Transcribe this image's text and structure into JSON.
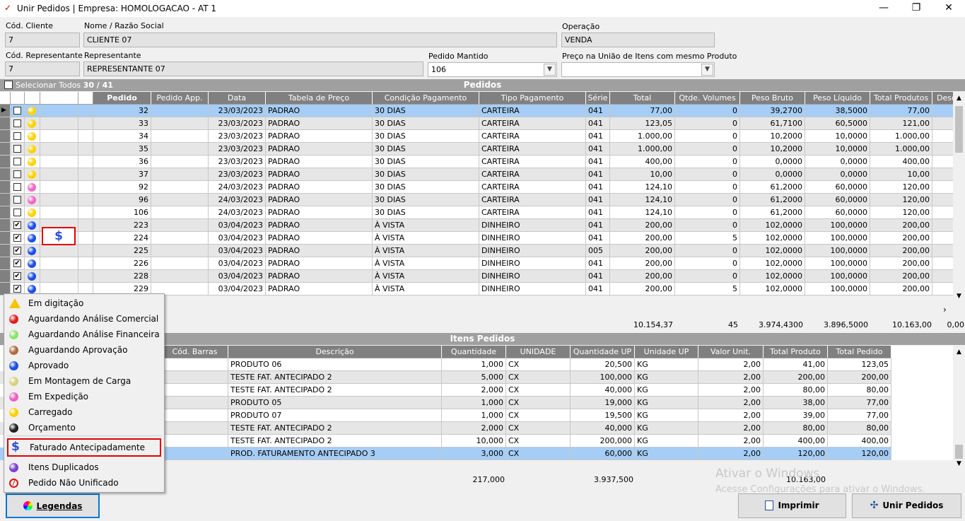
{
  "window": {
    "title": "Unir Pedidos | Empresa: HOMOLOGACAO - AT 1",
    "min": "—",
    "max": "❐",
    "close": "✕"
  },
  "form": {
    "cod_cliente_label": "Cód. Cliente",
    "cod_cliente": "7",
    "nome_label": "Nome / Razão Social",
    "nome": "CLIENTE 07",
    "operacao_label": "Operação",
    "operacao": "VENDA",
    "cod_rep_label": "Cód. Representante",
    "cod_rep": "7",
    "rep_label": "Representante",
    "rep": "REPRESENTANTE 07",
    "pedido_mantido_label": "Pedido Mantido",
    "pedido_mantido": "106",
    "preco_label": "Preço na União de Itens com mesmo Produto",
    "preco": ""
  },
  "pedidos": {
    "select_all_label": "Selecionar Todos",
    "count": "30 / 41",
    "title": "Pedidos",
    "columns": [
      "Pedido",
      "Pedido App.",
      "Data",
      "Tabela de Preço",
      "Condição Pagamento",
      "Tipo Pagamento",
      "Série",
      "Total",
      "Qtde. Volumes",
      "Peso Bruto",
      "Peso Líquido",
      "Total Produtos",
      "Desc"
    ],
    "rows": [
      {
        "checked": false,
        "status": "carregado",
        "pedido": "32",
        "app": "",
        "data": "23/03/2023",
        "tabela": "PADRAO",
        "cond": "30 DIAS",
        "tipo": "CARTEIRA",
        "serie": "041",
        "total": "77,00",
        "vol": "0",
        "bruto": "39,2700",
        "liq": "38,5000",
        "totprod": "77,00",
        "selected": true
      },
      {
        "checked": false,
        "status": "carregado",
        "pedido": "33",
        "app": "",
        "data": "23/03/2023",
        "tabela": "PADRAO",
        "cond": "30 DIAS",
        "tipo": "CARTEIRA",
        "serie": "041",
        "total": "123,05",
        "vol": "0",
        "bruto": "61,7100",
        "liq": "60,5000",
        "totprod": "121,00"
      },
      {
        "checked": false,
        "status": "carregado",
        "pedido": "34",
        "app": "",
        "data": "23/03/2023",
        "tabela": "PADRAO",
        "cond": "30 DIAS",
        "tipo": "CARTEIRA",
        "serie": "041",
        "total": "1.000,00",
        "vol": "0",
        "bruto": "10,2000",
        "liq": "10,0000",
        "totprod": "1.000,00"
      },
      {
        "checked": false,
        "status": "carregado",
        "pedido": "35",
        "app": "",
        "data": "23/03/2023",
        "tabela": "PADRAO",
        "cond": "30 DIAS",
        "tipo": "CARTEIRA",
        "serie": "041",
        "total": "1.000,00",
        "vol": "0",
        "bruto": "10,2000",
        "liq": "10,0000",
        "totprod": "1.000,00"
      },
      {
        "checked": false,
        "status": "carregado",
        "pedido": "36",
        "app": "",
        "data": "23/03/2023",
        "tabela": "PADRAO",
        "cond": "30 DIAS",
        "tipo": "CARTEIRA",
        "serie": "041",
        "total": "400,00",
        "vol": "0",
        "bruto": "0,0000",
        "liq": "0,0000",
        "totprod": "400,00"
      },
      {
        "checked": false,
        "status": "carregado",
        "pedido": "37",
        "app": "",
        "data": "23/03/2023",
        "tabela": "PADRAO",
        "cond": "30 DIAS",
        "tipo": "CARTEIRA",
        "serie": "041",
        "total": "10,00",
        "vol": "0",
        "bruto": "0,0000",
        "liq": "0,0000",
        "totprod": "10,00"
      },
      {
        "checked": false,
        "status": "expedicao",
        "pedido": "92",
        "app": "",
        "data": "24/03/2023",
        "tabela": "PADRAO",
        "cond": "30 DIAS",
        "tipo": "CARTEIRA",
        "serie": "041",
        "total": "124,10",
        "vol": "0",
        "bruto": "61,2000",
        "liq": "60,0000",
        "totprod": "120,00"
      },
      {
        "checked": false,
        "status": "expedicao",
        "pedido": "96",
        "app": "",
        "data": "24/03/2023",
        "tabela": "PADRAO",
        "cond": "30 DIAS",
        "tipo": "CARTEIRA",
        "serie": "041",
        "total": "124,10",
        "vol": "0",
        "bruto": "61,2000",
        "liq": "60,0000",
        "totprod": "120,00"
      },
      {
        "checked": false,
        "status": "carregado",
        "pedido": "106",
        "app": "",
        "data": "24/03/2023",
        "tabela": "PADRAO",
        "cond": "30 DIAS",
        "tipo": "CARTEIRA",
        "serie": "041",
        "total": "124,10",
        "vol": "0",
        "bruto": "61,2000",
        "liq": "60,0000",
        "totprod": "120,00"
      },
      {
        "checked": true,
        "status": "aprovado",
        "pedido": "223",
        "app": "",
        "data": "03/04/2023",
        "tabela": "PADRAO",
        "cond": "À VISTA",
        "tipo": "DINHEIRO",
        "serie": "041",
        "total": "200,00",
        "vol": "0",
        "bruto": "102,0000",
        "liq": "100,0000",
        "totprod": "200,00"
      },
      {
        "checked": true,
        "status": "aprovado",
        "pedido": "224",
        "app": "$",
        "data": "03/04/2023",
        "tabela": "PADRAO",
        "cond": "À VISTA",
        "tipo": "DINHEIRO",
        "serie": "041",
        "total": "200,00",
        "vol": "5",
        "bruto": "102,0000",
        "liq": "100,0000",
        "totprod": "200,00"
      },
      {
        "checked": true,
        "status": "aprovado",
        "pedido": "225",
        "app": "",
        "data": "03/04/2023",
        "tabela": "PADRAO",
        "cond": "À VISTA",
        "tipo": "DINHEIRO",
        "serie": "005",
        "total": "200,00",
        "vol": "0",
        "bruto": "102,0000",
        "liq": "100,0000",
        "totprod": "200,00"
      },
      {
        "checked": true,
        "status": "aprovado",
        "pedido": "226",
        "app": "",
        "data": "03/04/2023",
        "tabela": "PADRAO",
        "cond": "À VISTA",
        "tipo": "DINHEIRO",
        "serie": "041",
        "total": "200,00",
        "vol": "0",
        "bruto": "102,0000",
        "liq": "100,0000",
        "totprod": "200,00"
      },
      {
        "checked": true,
        "status": "aprovado",
        "pedido": "228",
        "app": "",
        "data": "03/04/2023",
        "tabela": "PADRAO",
        "cond": "À VISTA",
        "tipo": "DINHEIRO",
        "serie": "041",
        "total": "200,00",
        "vol": "0",
        "bruto": "102,0000",
        "liq": "100,0000",
        "totprod": "200,00"
      },
      {
        "checked": true,
        "status": "aprovado",
        "pedido": "229",
        "app": "",
        "data": "03/04/2023",
        "tabela": "PADRAO",
        "cond": "À VISTA",
        "tipo": "DINHEIRO",
        "serie": "041",
        "total": "200,00",
        "vol": "5",
        "bruto": "102,0000",
        "liq": "100,0000",
        "totprod": "200,00"
      }
    ],
    "totals": {
      "total": "10.154,37",
      "vol": "45",
      "bruto": "3.974,4300",
      "liq": "3.896,5000",
      "totprod": "10.163,00",
      "desc": "0,00"
    }
  },
  "itens": {
    "title": "Itens Pedidos",
    "columns": [
      "Cód. Barras",
      "Descrição",
      "Quantidade",
      "UNIDADE",
      "Quantidade UP",
      "Unidade UP",
      "Valor Unit.",
      "Total Produto",
      "Total Pedido"
    ],
    "rows": [
      {
        "desc": "PRODUTO 06",
        "qtd": "1,000",
        "un": "CX",
        "qup": "20,500",
        "uup": "KG",
        "vu": "2,00",
        "tp": "41,00",
        "tped": "123,05"
      },
      {
        "desc": "TESTE FAT. ANTECIPADO 2",
        "qtd": "5,000",
        "un": "CX",
        "qup": "100,000",
        "uup": "KG",
        "vu": "2,00",
        "tp": "200,00",
        "tped": "200,00"
      },
      {
        "desc": "TESTE FAT. ANTECIPADO 2",
        "qtd": "2,000",
        "un": "CX",
        "qup": "40,000",
        "uup": "KG",
        "vu": "2,00",
        "tp": "80,00",
        "tped": "80,00"
      },
      {
        "desc": "PRODUTO 05",
        "qtd": "1,000",
        "un": "CX",
        "qup": "19,000",
        "uup": "KG",
        "vu": "2,00",
        "tp": "38,00",
        "tped": "77,00"
      },
      {
        "desc": "PRODUTO 07",
        "qtd": "1,000",
        "un": "CX",
        "qup": "19,500",
        "uup": "KG",
        "vu": "2,00",
        "tp": "39,00",
        "tped": "77,00"
      },
      {
        "desc": "TESTE FAT. ANTECIPADO 2",
        "qtd": "2,000",
        "un": "CX",
        "qup": "40,000",
        "uup": "KG",
        "vu": "2,00",
        "tp": "80,00",
        "tped": "80,00"
      },
      {
        "desc": "TESTE FAT. ANTECIPADO 2",
        "qtd": "10,000",
        "un": "CX",
        "qup": "200,000",
        "uup": "KG",
        "vu": "2,00",
        "tp": "400,00",
        "tped": "400,00"
      },
      {
        "desc": "PROD. FATURAMENTO ANTECIPADO 3",
        "qtd": "3,000",
        "un": "CX",
        "qup": "60,000",
        "uup": "KG",
        "vu": "2,00",
        "tp": "120,00",
        "tped": "120,00",
        "selected": true
      }
    ],
    "totals": {
      "qtd": "217,000",
      "qup": "3.937,500",
      "tped": "10.163,00"
    }
  },
  "legend_menu": [
    {
      "label": "Em digitação",
      "icon": "warning-icon",
      "color": "#f5c400"
    },
    {
      "label": "Aguardando Análise Comercial",
      "icon": "red-dot-icon",
      "color": "#e02020"
    },
    {
      "label": "Aguardando Análise Financeira",
      "icon": "lightgreen-dot-icon",
      "color": "#90e070"
    },
    {
      "label": "Aguardando Aprovação",
      "icon": "brown-dot-icon",
      "color": "#b06a40"
    },
    {
      "label": "Aprovado",
      "icon": "blue-dot-icon",
      "color": "#1a4fe0"
    },
    {
      "label": "Em Montagem de Carga",
      "icon": "olive-dot-icon",
      "color": "#d8d080"
    },
    {
      "label": "Em Expedição",
      "icon": "pink-dot-icon",
      "color": "#f060c0"
    },
    {
      "label": "Carregado",
      "icon": "yellow-dot-icon",
      "color": "#ffd000"
    },
    {
      "label": "Orçamento",
      "icon": "black-dot-icon",
      "color": "#202020"
    },
    {
      "label": "Faturado Antecipadamente",
      "icon": "dollar-icon",
      "color": "#2a50d0"
    },
    {
      "label": "Itens Duplicados",
      "icon": "purple-dot-icon",
      "color": "#7a40d0"
    },
    {
      "label": "Pedido Não Unificado",
      "icon": "forbidden-icon",
      "color": "#e01010"
    }
  ],
  "buttons": {
    "legendas": "Legendas",
    "imprimir": "Imprimir",
    "unir": "Unir Pedidos"
  },
  "watermark": {
    "line1": "Ativar o Windows",
    "line2": "Acesse Configurações para ativar o Windows."
  },
  "colors": {
    "selected_row": "#a6cdf5",
    "section_header": "#a0a0a0",
    "highlight_border": "#e00000"
  }
}
